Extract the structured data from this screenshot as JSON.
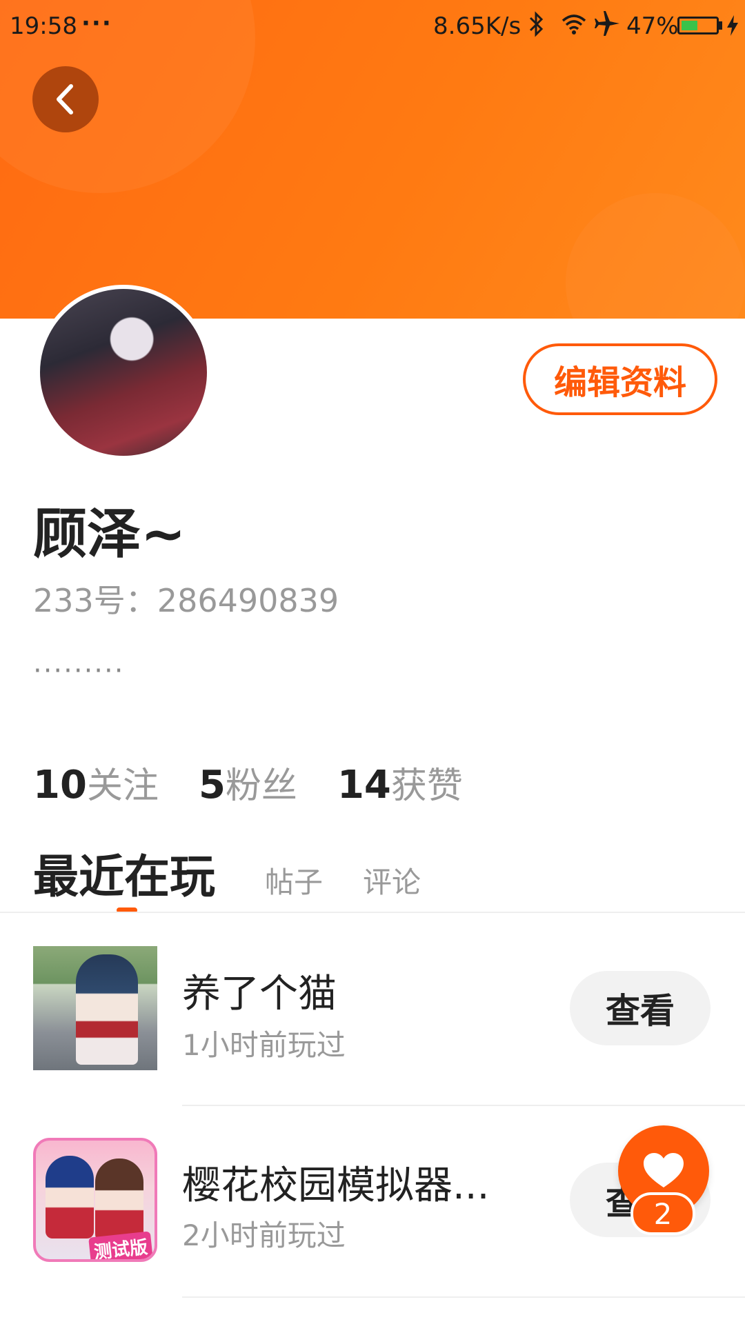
{
  "status_bar": {
    "time": "19:58",
    "dots": "···",
    "speed": "8.65K/s",
    "battery": "47%",
    "battery_level": 0.47
  },
  "profile": {
    "edit_label": "编辑资料",
    "username": "顾泽~",
    "id_text": "233号：286490839",
    "bio": "·········"
  },
  "stats": [
    {
      "count": "10",
      "label": "关注"
    },
    {
      "count": "5",
      "label": "粉丝"
    },
    {
      "count": "14",
      "label": "获赞"
    }
  ],
  "tabs": {
    "active": "最近在玩",
    "posts": "帖子",
    "comments": "评论"
  },
  "games": [
    {
      "title": "养了个猫",
      "subtitle": "1小时前玩过",
      "button": "查看"
    },
    {
      "title": "樱花校园模拟器...",
      "subtitle": "2小时前玩过",
      "button": "查看",
      "thumb_badge": "测试版"
    }
  ],
  "likes": {
    "count": "2"
  },
  "colors": {
    "accent": "#ff5a0a",
    "header": "#ff7a12"
  }
}
